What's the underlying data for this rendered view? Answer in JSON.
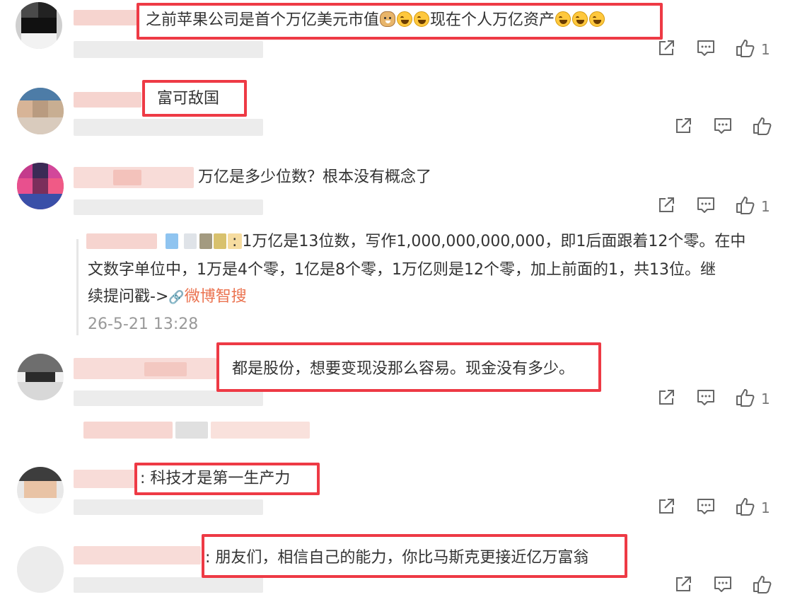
{
  "comments": [
    {
      "text_parts": [
        "之前苹果公司是首个万亿美元市值",
        "现在个人万亿资产"
      ],
      "likes": "1"
    },
    {
      "text": "富可敌国",
      "likes": ""
    },
    {
      "text": "万亿是多少位数？根本没有概念了",
      "likes": "1",
      "reply": {
        "line1": ": 1万亿是13位数，写作1,000,000,000,000，即1后面跟着12个零。在中",
        "line2": "文数字单位中，1万是4个零，1亿是8个零，1万亿则是12个零，加上前面的1，共13位。继",
        "line3_prefix": "续提问戳->",
        "link_icon": "🔗",
        "link": "微博智搜",
        "timestamp": "26-5-21 13:28"
      }
    },
    {
      "text": "都是股份，想要变现没那么容易。现金没有多少。",
      "likes": "1"
    },
    {
      "text": ": 科技才是第一生产力",
      "likes": "1"
    },
    {
      "text": ": 朋友们，相信自己的能力，你比马斯克更接近亿万富翁",
      "likes": ""
    }
  ],
  "icons": {
    "share": "share-icon",
    "comment": "comment-icon",
    "like": "thumbs-up-icon",
    "emoji_doge": "doge-emoji-icon",
    "emoji_laugh": "laugh-cry-emoji-icon"
  },
  "colors": {
    "highlight": "#ee3a45",
    "link": "#eb7350",
    "timestamp": "#999999"
  }
}
